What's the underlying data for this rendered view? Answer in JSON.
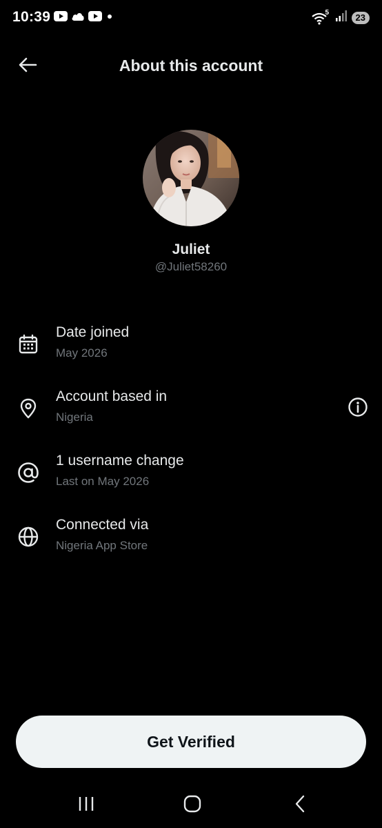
{
  "status_bar": {
    "time": "10:39",
    "battery": "23",
    "wifi_label": "5",
    "icons": [
      "youtube-icon",
      "cloud-icon",
      "youtube-icon",
      "dot-icon",
      "wifi-icon",
      "signal-icon",
      "battery-icon"
    ]
  },
  "header": {
    "title": "About this account",
    "back_icon": "back-arrow-icon"
  },
  "profile": {
    "name": "Juliet",
    "handle": "@Juliet58260"
  },
  "info": [
    {
      "icon": "calendar-icon",
      "title": "Date joined",
      "subtitle": "May 2026"
    },
    {
      "icon": "location-pin-icon",
      "title": "Account based in",
      "subtitle": "Nigeria",
      "action_icon": "info-icon"
    },
    {
      "icon": "at-sign-icon",
      "title": "1 username change",
      "subtitle": "Last on May 2026"
    },
    {
      "icon": "globe-icon",
      "title": "Connected via",
      "subtitle": "Nigeria App Store"
    }
  ],
  "cta": {
    "label": "Get Verified"
  },
  "nav": {
    "icons": [
      "recents-icon",
      "home-icon",
      "back-icon"
    ]
  },
  "colors": {
    "background": "#000000",
    "primary_text": "#e7e9ea",
    "secondary_text": "#71767b",
    "button_bg": "#eff3f4",
    "button_text": "#0f1419"
  }
}
